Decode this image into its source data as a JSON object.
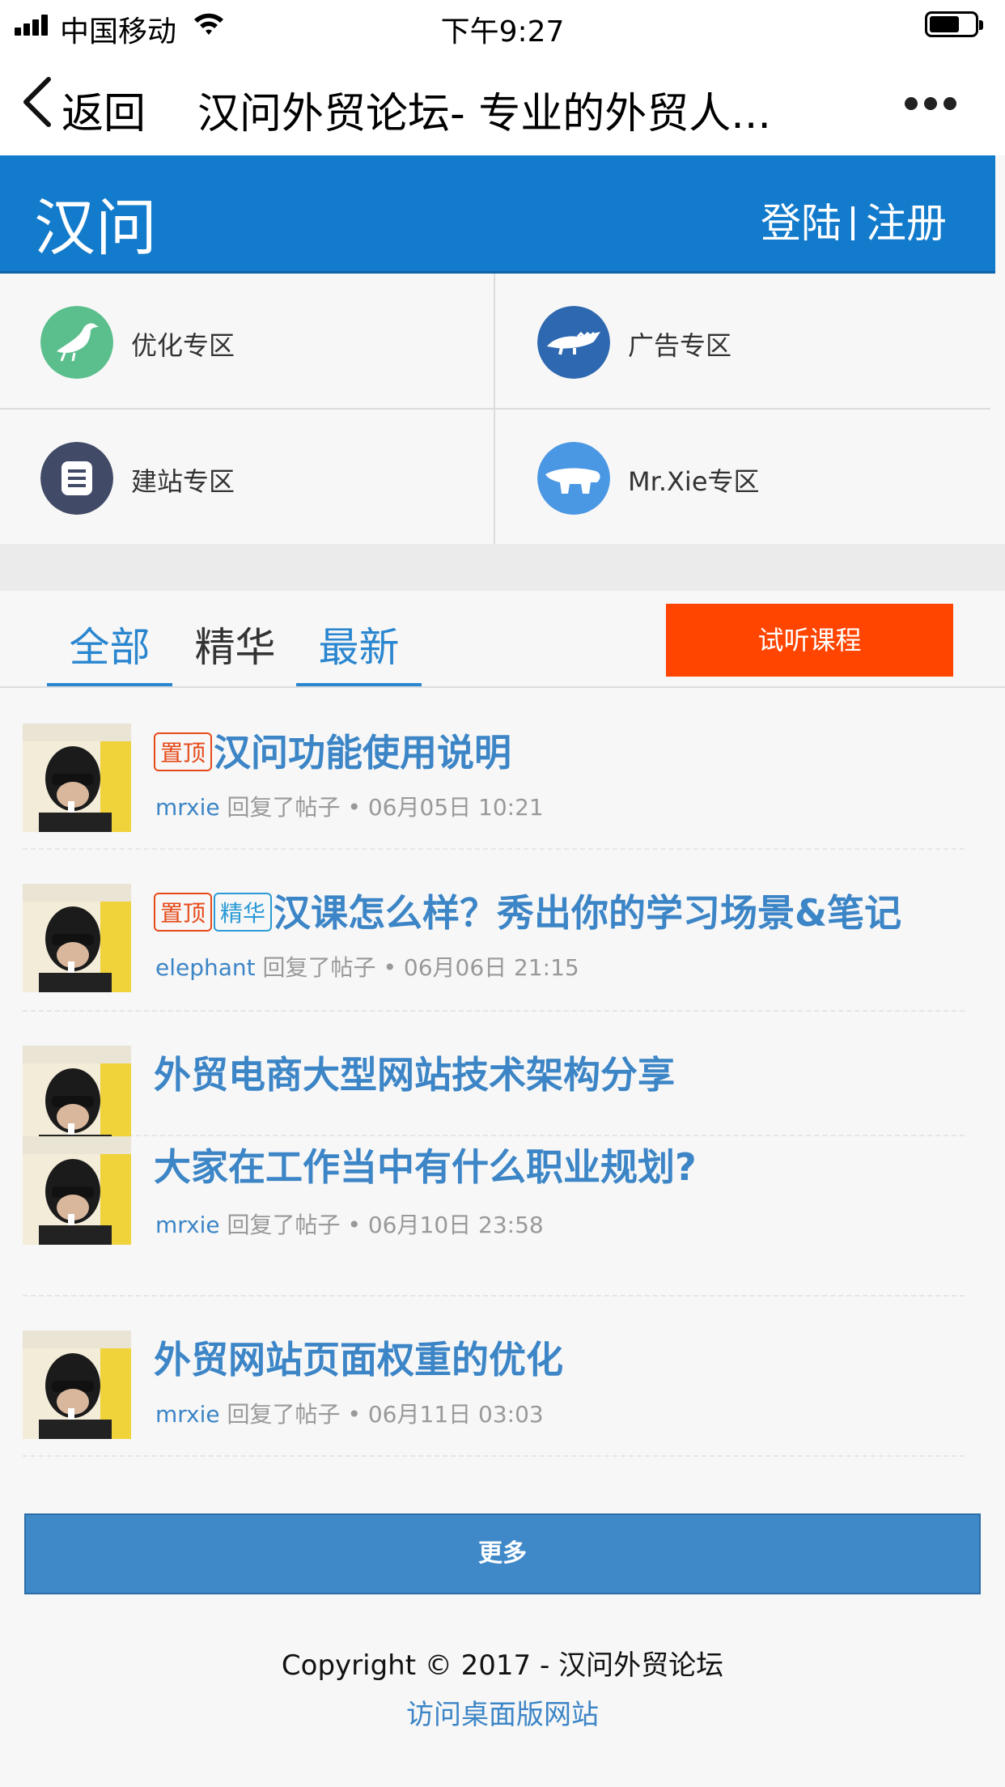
{
  "status_bar": {
    "carrier": "中国移动",
    "time": "下午9:27"
  },
  "nav_bar": {
    "back_label": "返回",
    "title": "汉问外贸论坛- 专业的外贸人..."
  },
  "header": {
    "logo": "汉问",
    "login": "登陆",
    "register": "注册",
    "brand_color": "#137bcb"
  },
  "categories": [
    {
      "label": "优化专区",
      "icon": "bird-icon",
      "color": "#5bbf8d"
    },
    {
      "label": "广告专区",
      "icon": "crocodile-icon",
      "color": "#2e68b0"
    },
    {
      "label": "建站专区",
      "icon": "list-icon",
      "color": "#414a66"
    },
    {
      "label": "Mr.Xie专区",
      "icon": "bear-icon",
      "color": "#4a97e4"
    }
  ],
  "tabs": [
    {
      "label": "全部",
      "active": true
    },
    {
      "label": "精华",
      "active": false
    },
    {
      "label": "最新",
      "active": true
    }
  ],
  "trial_button": "试听课程",
  "badges": {
    "top": "置顶",
    "essence": "精华"
  },
  "posts": [
    {
      "title": "汉问功能使用说明",
      "author": "mrxie",
      "action": "回复了帖子",
      "time": "• 06月05日 10:21"
    },
    {
      "title": "汉课怎么样？秀出你的学习场景&笔记",
      "author": "elephant",
      "action": "回复了帖子",
      "time": "• 06月06日 21:15"
    },
    {
      "title": "外贸电商大型网站技术架构分享"
    },
    {
      "title": "大家在工作当中有什么职业规划?",
      "author": "mrxie",
      "action": "回复了帖子",
      "time": "• 06月10日 23:58"
    },
    {
      "title": "外贸网站页面权重的优化",
      "author": "mrxie",
      "action": "回复了帖子",
      "time": "• 06月11日 03:03"
    }
  ],
  "more_button": "更多",
  "footer": {
    "copyright": "Copyright © 2017 - 汉问外贸论坛",
    "desktop_link": "访问桌面版网站"
  }
}
